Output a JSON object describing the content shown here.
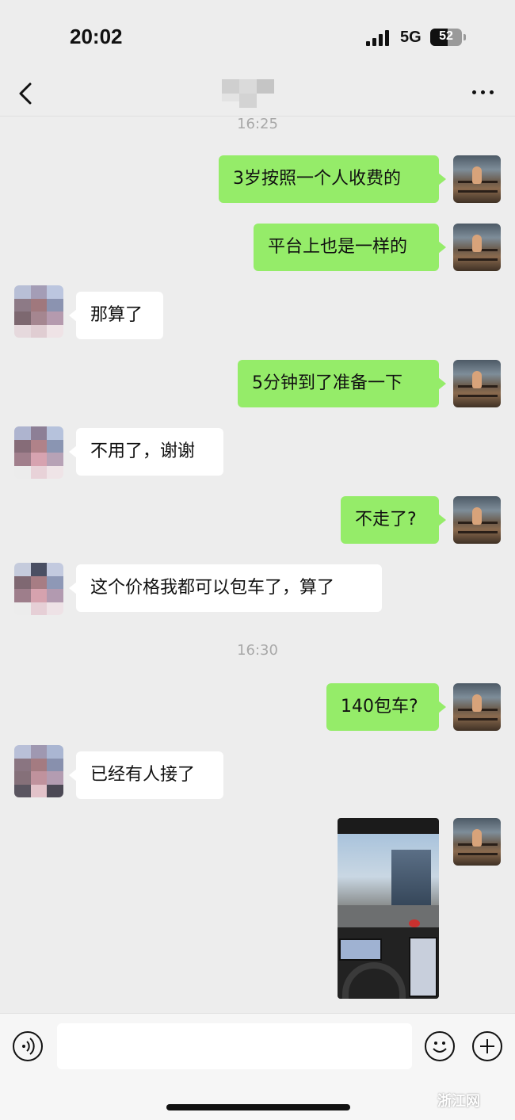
{
  "status_bar": {
    "time": "20:02",
    "network": "5G",
    "battery": "52"
  },
  "nav": {
    "title": "",
    "back_icon": "chevron-left-icon",
    "more_icon": "more-dots-icon"
  },
  "colors": {
    "background": "#ededed",
    "my_bubble": "#95ec69",
    "their_bubble": "#ffffff",
    "timestamp": "#a8a8a8"
  },
  "chat": {
    "timestamps": [
      "16:25",
      "16:30"
    ],
    "messages": [
      {
        "from": "me",
        "text": "3岁按照一个人收费的"
      },
      {
        "from": "me",
        "text": "平台上也是一样的"
      },
      {
        "from": "them",
        "text": "那算了"
      },
      {
        "from": "me",
        "text": "5分钟到了准备一下"
      },
      {
        "from": "them",
        "text": "不用了，谢谢"
      },
      {
        "from": "me",
        "text": "不走了?"
      },
      {
        "from": "them",
        "text": "这个价格我都可以包车了，算了"
      },
      {
        "from": "me",
        "text": "140包车?"
      },
      {
        "from": "them",
        "text": "已经有人接了"
      },
      {
        "from": "me",
        "type": "image"
      }
    ]
  },
  "input_bar": {
    "placeholder": "",
    "voice_icon": "voice-icon",
    "emoji_icon": "emoji-icon",
    "plus_icon": "plus-icon"
  },
  "watermark": "浙江网"
}
